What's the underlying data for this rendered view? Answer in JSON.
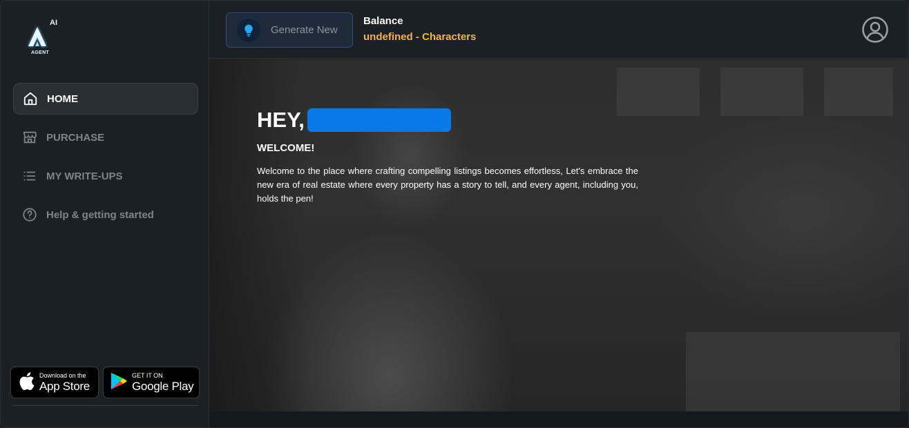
{
  "logo": {
    "mark": "AI",
    "sub": "AGENT"
  },
  "nav": {
    "items": [
      {
        "label": "HOME",
        "icon": "home-icon",
        "active": true
      },
      {
        "label": "PURCHASE",
        "icon": "store-icon",
        "active": false
      },
      {
        "label": "MY WRITE-UPS",
        "icon": "list-icon",
        "active": false
      },
      {
        "label": "Help & getting started",
        "icon": "help-icon",
        "active": false
      }
    ]
  },
  "stores": {
    "apple": {
      "small": "Download on the",
      "big": "App Store"
    },
    "google": {
      "small": "GET IT ON",
      "big": "Google Play"
    }
  },
  "header": {
    "generate_label": "Generate New",
    "balance_title": "Balance",
    "balance_value": "undefined - Characters"
  },
  "hero": {
    "greeting": "HEY,",
    "welcome": "WELCOME!",
    "description": "Welcome to the place where crafting compelling listings becomes effortless, Let's embrace the new era of real estate where every property has a story to tell, and every agent, including you, holds the pen!"
  },
  "colors": {
    "accent": "#f2b632",
    "redaction": "#0a79e8",
    "sidebar_bg": "#1b2024"
  }
}
